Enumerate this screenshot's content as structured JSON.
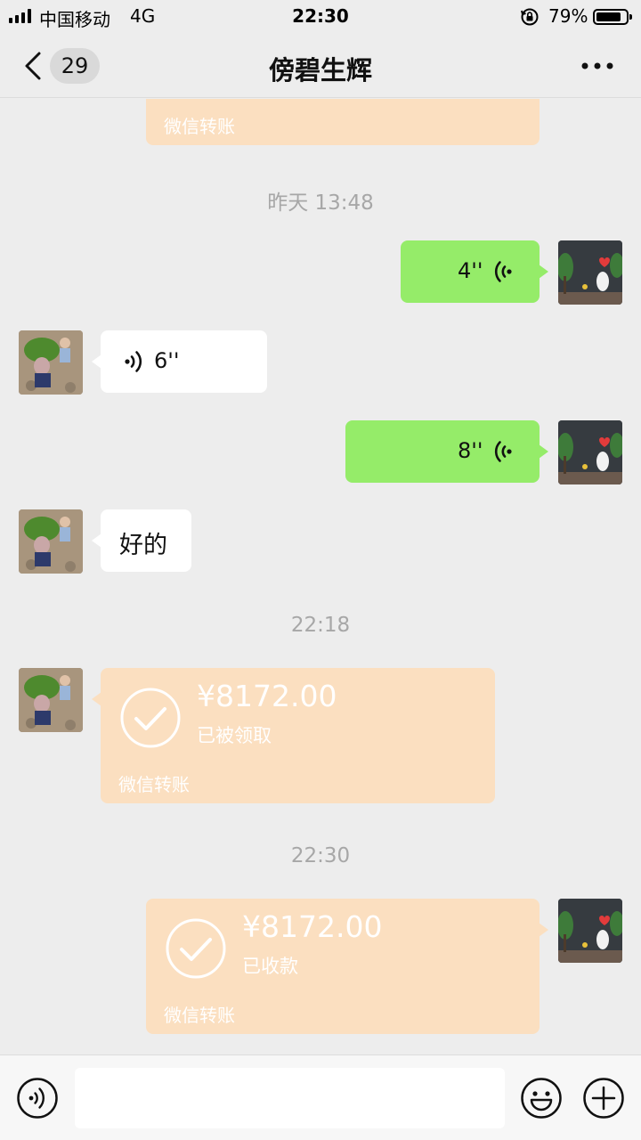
{
  "status_bar": {
    "carrier": "中国移动",
    "network": "4G",
    "time": "22:30",
    "battery": "79%"
  },
  "nav": {
    "unread_count": "29",
    "title": "傍碧生辉"
  },
  "messages": {
    "top_transfer_label": "微信转账",
    "ts1": "昨天 13:48",
    "voice1_duration": "4''",
    "voice2_duration": "6''",
    "voice3_duration": "8''",
    "text1": "好的",
    "ts2": "22:18",
    "transfer1": {
      "amount": "¥8172.00",
      "status": "已被领取",
      "label": "微信转账"
    },
    "ts3": "22:30",
    "transfer2": {
      "amount": "¥8172.00",
      "status": "已收款",
      "label": "微信转账"
    }
  },
  "input": {
    "placeholder": ""
  },
  "colors": {
    "self_bubble": "#95ec69",
    "other_bubble": "#ffffff",
    "transfer_bubble": "#fbdfc0",
    "background": "#ededed"
  }
}
